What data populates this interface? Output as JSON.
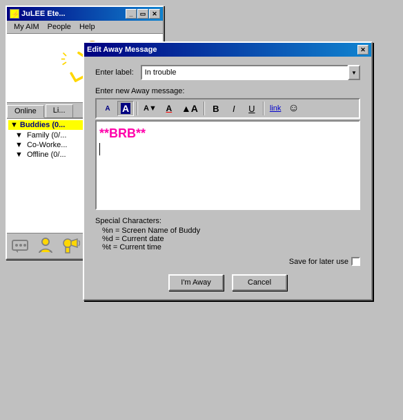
{
  "aim_window": {
    "title": "JuLEE Ete...",
    "menu": {
      "items": [
        "My AIM",
        "People",
        "Help"
      ]
    },
    "tabs": [
      "Online",
      "Li..."
    ],
    "buddy_groups": [
      {
        "label": "Buddies (0...",
        "count": "0"
      },
      {
        "label": "Family (0/...",
        "count": "0"
      },
      {
        "label": "Co-Worke...",
        "count": "0"
      },
      {
        "label": "Offline (0/...",
        "count": "0"
      }
    ]
  },
  "dialog": {
    "title": "Edit Away Message",
    "enter_label_text": "Enter label:",
    "label_value": "In trouble",
    "enter_message_text": "Enter new Away message:",
    "message_content": "**BRB**",
    "toolbar": {
      "font_small": "A",
      "font_large": "A",
      "font_down_arrow": "A▼",
      "font_color": "A",
      "font_big_a": "▲A",
      "bold": "B",
      "italic": "I",
      "underline": "U",
      "link": "link",
      "smiley": "☺"
    },
    "special_chars": {
      "title": "Special Characters:",
      "lines": [
        "%n  =  Screen Name of Buddy",
        "%d  =  Current date",
        "%t   =  Current time"
      ]
    },
    "save_label": "Save for later use",
    "buttons": {
      "im_away": "I'm Away",
      "cancel": "Cancel"
    }
  },
  "bottom_bar": {
    "icons": [
      "chat-icon",
      "buddy-icon",
      "announce-icon"
    ]
  }
}
